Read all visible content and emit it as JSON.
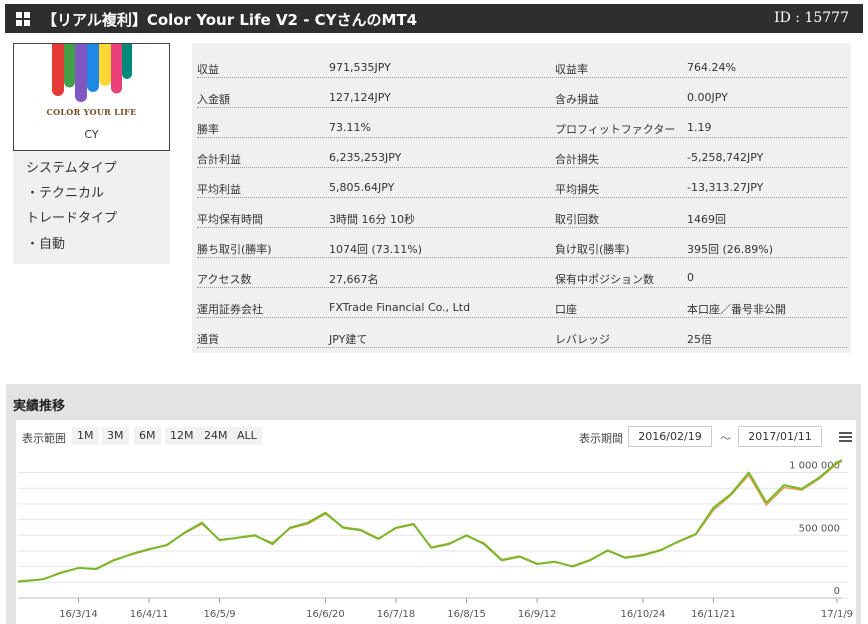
{
  "header": {
    "title": "【リアル複利】Color Your Life V2 - CYさんのMT4",
    "id_text": "ID : 15777"
  },
  "profile": {
    "logo_text": "COLOR YOUR LIFE",
    "name": "CY",
    "system_type_label": "システムタイプ",
    "system_type_value": "・テクニカル",
    "trade_type_label": "トレードタイプ",
    "trade_type_value": "・自動"
  },
  "stats": [
    {
      "l1": "収益",
      "v1": "971,535JPY",
      "l2": "収益率",
      "v2": "764.24%"
    },
    {
      "l1": "入金額",
      "v1": "127,124JPY",
      "l2": "含み損益",
      "v2": "0.00JPY"
    },
    {
      "l1": "勝率",
      "v1": "73.11%",
      "l2": "プロフィットファクター",
      "v2": "1.19"
    },
    {
      "l1": "合計利益",
      "v1": "6,235,253JPY",
      "l2": "合計損失",
      "v2": "-5,258,742JPY"
    },
    {
      "l1": "平均利益",
      "v1": "5,805.64JPY",
      "l2": "平均損失",
      "v2": "-13,313.27JPY"
    },
    {
      "l1": "平均保有時間",
      "v1": "3時間 16分 10秒",
      "l2": "取引回数",
      "v2": "1469回"
    },
    {
      "l1": "勝ち取引(勝率)",
      "v1": "1074回 (73.11%)",
      "l2": "負け取引(勝率)",
      "v2": "395回 (26.89%)"
    },
    {
      "l1": "アクセス数",
      "v1": "27,667名",
      "l2": "保有中ポジション数",
      "v2": "0"
    },
    {
      "l1": "運用証券会社",
      "v1": "FXTrade Financial Co., Ltd",
      "l2": "口座",
      "v2": "本口座／番号非公開"
    },
    {
      "l1": "通貨",
      "v1": "JPY建て",
      "l2": "レバレッジ",
      "v2": "25倍"
    }
  ],
  "performance": {
    "title": "実績推移",
    "range_label": "表示範囲",
    "range_buttons": [
      "1M",
      "3M",
      "6M",
      "12M",
      "24M",
      "ALL"
    ],
    "period_label": "表示期間",
    "date_from": "2016/02/19",
    "tilde": "～",
    "date_to": "2017/01/11"
  },
  "colors": {
    "header_bg": "#2e2e2e",
    "line_green": "#76b82a",
    "line_orange": "#e8a05a"
  },
  "chart_data": {
    "type": "line",
    "title": "",
    "xlabel": "",
    "ylabel": "",
    "x_ticks": [
      "16/3/14",
      "16/4/11",
      "16/5/9",
      "16/6/20",
      "16/7/18",
      "16/8/15",
      "16/9/12",
      "16/10/24",
      "16/11/21",
      "17/1/9"
    ],
    "y_ticks": [
      0,
      500000,
      1000000
    ],
    "y_tick_labels": [
      "0",
      "500 000",
      "1 000 000"
    ],
    "ylim": [
      0,
      1100000
    ],
    "x": [
      "2016-02-19",
      "2016-02-29",
      "2016-03-07",
      "2016-03-14",
      "2016-03-21",
      "2016-03-28",
      "2016-04-04",
      "2016-04-11",
      "2016-04-18",
      "2016-04-25",
      "2016-05-02",
      "2016-05-09",
      "2016-05-16",
      "2016-05-23",
      "2016-05-30",
      "2016-06-06",
      "2016-06-13",
      "2016-06-20",
      "2016-06-27",
      "2016-07-04",
      "2016-07-11",
      "2016-07-18",
      "2016-07-25",
      "2016-08-01",
      "2016-08-08",
      "2016-08-15",
      "2016-08-22",
      "2016-08-29",
      "2016-09-05",
      "2016-09-12",
      "2016-09-19",
      "2016-09-26",
      "2016-10-03",
      "2016-10-10",
      "2016-10-17",
      "2016-10-24",
      "2016-10-31",
      "2016-11-07",
      "2016-11-14",
      "2016-11-21",
      "2016-11-28",
      "2016-12-05",
      "2016-12-12",
      "2016-12-19",
      "2016-12-26",
      "2017-01-02",
      "2017-01-09",
      "2017-01-11"
    ],
    "series": [
      {
        "values": [
          130000,
          150000,
          200000,
          240000,
          230000,
          300000,
          350000,
          390000,
          420000,
          520000,
          600000,
          460000,
          480000,
          500000,
          430000,
          560000,
          600000,
          680000,
          560000,
          540000,
          470000,
          560000,
          590000,
          400000,
          430000,
          500000,
          430000,
          300000,
          330000,
          270000,
          290000,
          250000,
          300000,
          380000,
          320000,
          340000,
          380000,
          450000,
          510000,
          720000,
          830000,
          1000000,
          760000,
          900000,
          870000,
          960000,
          1080000,
          1100000
        ]
      },
      {
        "values": [
          135000,
          148000,
          205000,
          238000,
          235000,
          305000,
          345000,
          385000,
          425000,
          515000,
          590000,
          465000,
          478000,
          495000,
          440000,
          555000,
          590000,
          670000,
          565000,
          545000,
          475000,
          555000,
          585000,
          405000,
          435000,
          495000,
          438000,
          305000,
          335000,
          275000,
          285000,
          255000,
          305000,
          375000,
          325000,
          345000,
          385000,
          445000,
          505000,
          700000,
          820000,
          980000,
          740000,
          880000,
          860000,
          950000,
          1070000,
          1090000
        ]
      }
    ]
  }
}
